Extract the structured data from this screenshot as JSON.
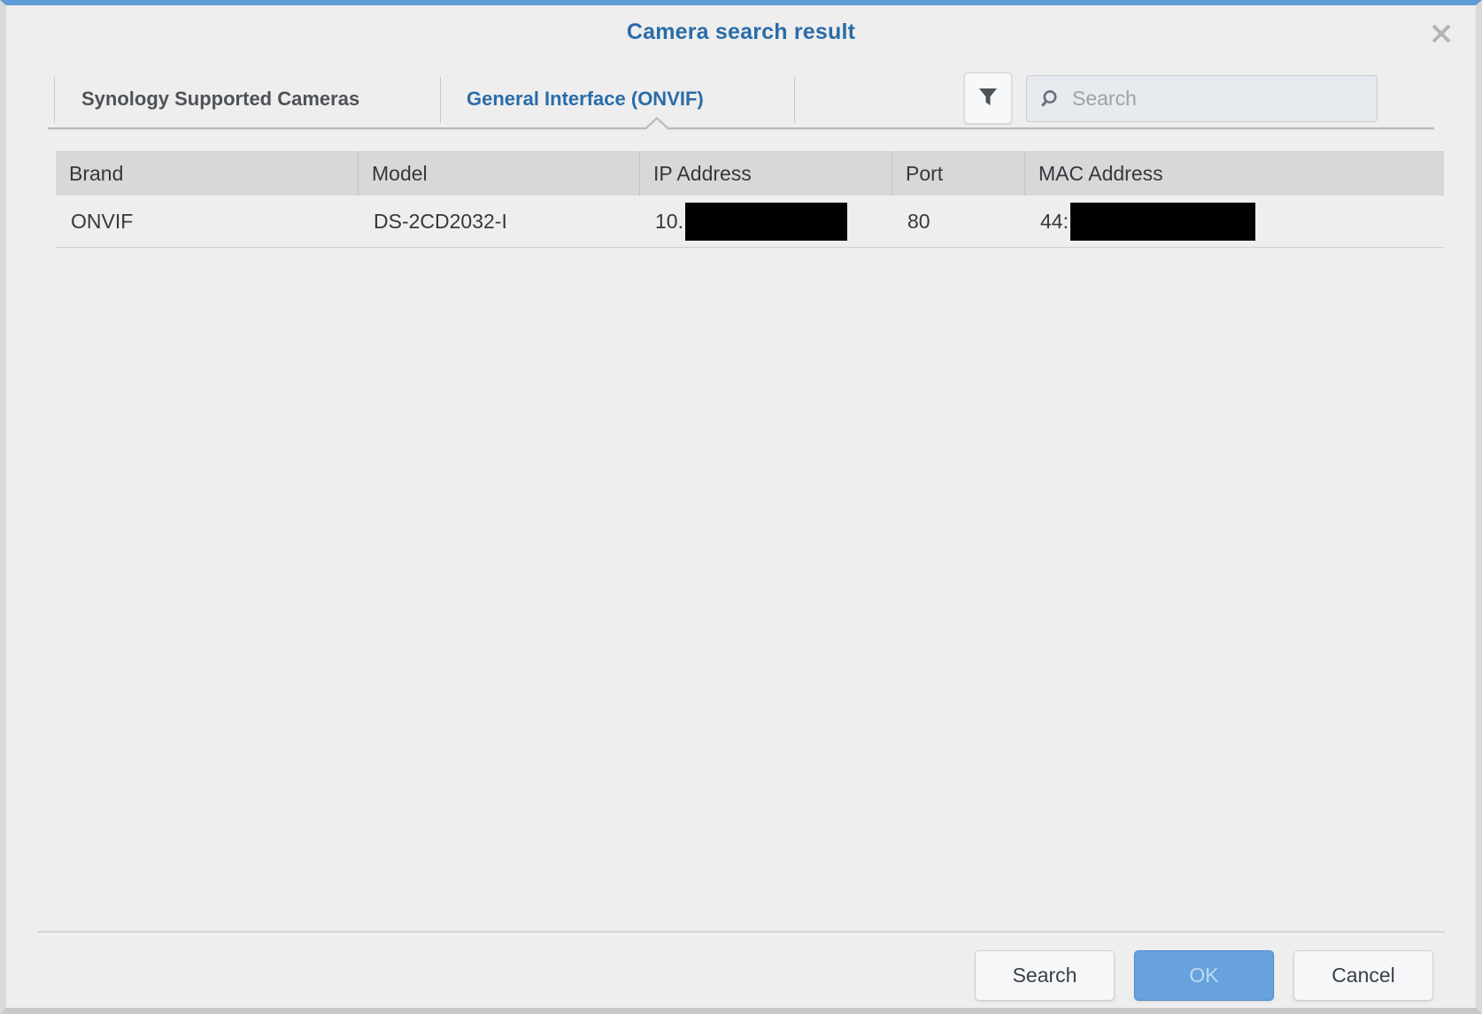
{
  "dialog": {
    "title": "Camera search result",
    "close_icon": "close-icon"
  },
  "tabs": [
    {
      "id": "synology",
      "label": "Synology Supported Cameras",
      "active": false
    },
    {
      "id": "onvif",
      "label": "General Interface (ONVIF)",
      "active": true
    }
  ],
  "toolbar": {
    "filter_icon": "filter-funnel-icon",
    "search": {
      "icon": "search-magnifier-icon",
      "placeholder": "Search",
      "value": ""
    }
  },
  "table": {
    "columns": [
      {
        "key": "brand",
        "label": "Brand"
      },
      {
        "key": "model",
        "label": "Model"
      },
      {
        "key": "ip",
        "label": "IP Address"
      },
      {
        "key": "port",
        "label": "Port"
      },
      {
        "key": "mac",
        "label": "MAC Address"
      }
    ],
    "rows": [
      {
        "brand": "ONVIF",
        "model": "DS-2CD2032-I",
        "ip_prefix": "10.",
        "ip_redacted": true,
        "port": "80",
        "mac_prefix": "44:",
        "mac_redacted": true
      }
    ]
  },
  "footer": {
    "buttons": [
      {
        "id": "search",
        "label": "Search",
        "style": "secondary",
        "disabled": false
      },
      {
        "id": "ok",
        "label": "OK",
        "style": "primary",
        "disabled": true
      },
      {
        "id": "cancel",
        "label": "Cancel",
        "style": "secondary",
        "disabled": false
      }
    ]
  },
  "colors": {
    "title_blue": "#2a6ca8",
    "accent_blue": "#5a9bd8",
    "primary_button": "#67a2de",
    "dialog_bg": "#eeeeee",
    "header_bg": "#d8d8d8",
    "redaction": "#000000"
  }
}
